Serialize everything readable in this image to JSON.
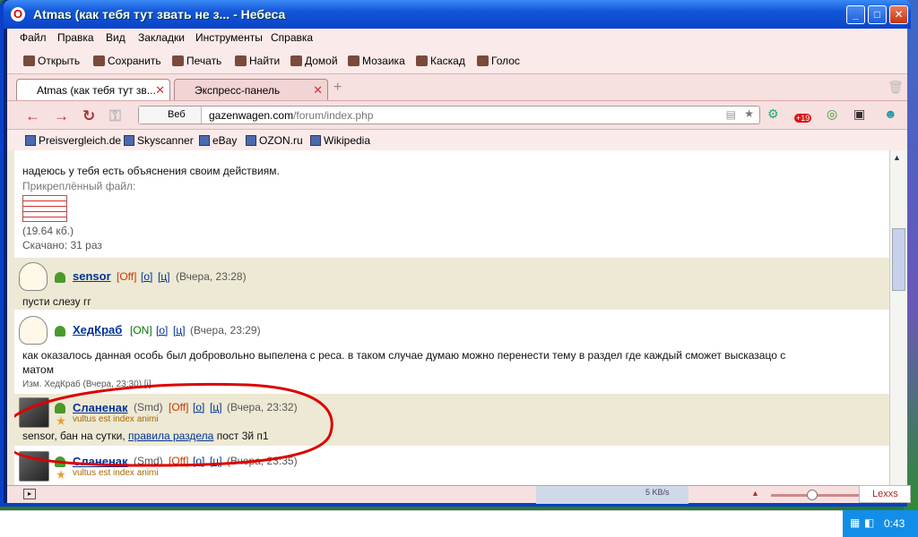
{
  "window": {
    "title": "Atmas (как тебя тут звать не з... - Небеса",
    "logo": "O"
  },
  "menu": [
    "Файл",
    "Правка",
    "Вид",
    "Закладки",
    "Инструменты",
    "Справка"
  ],
  "toolbar": [
    "Открыть",
    "Сохранить",
    "Печать",
    "Найти",
    "Домой",
    "Мозаика",
    "Каскад",
    "Голос"
  ],
  "tabs": [
    {
      "label": "Atmas (как тебя тут зв...",
      "active": true
    },
    {
      "label": "Экспресс-панель",
      "active": false
    }
  ],
  "address": {
    "mode": "Веб",
    "url_host": "gazenwagen.com",
    "url_path": "/forum/index.php",
    "badge": "+19"
  },
  "bookmarks": [
    "Preisvergleich.de",
    "Skyscanner",
    "eBay",
    "OZON.ru",
    "Wikipedia"
  ],
  "posts": [
    {
      "text": "надеюсь у тебя есть объяснения своим действиям.",
      "attached_label": "Прикреплённый файл:",
      "file_size": "(19.64 кб.)",
      "downloads": "Скачано: 31 раз"
    },
    {
      "user": "sensor",
      "status": "[Off]",
      "o": "[о]",
      "c": "[ц]",
      "time": "(Вчера, 23:28)",
      "text": "пусти слезу гг"
    },
    {
      "user": "ХедКраб",
      "status": "[ON]",
      "o": "[о]",
      "c": "[ц]",
      "time": "(Вчера, 23:29)",
      "text_line1": "как оказалось данная особь был добровольно выпелена с реса. в таком случае думаю можно перенести тему в раздел где каждый сможет высказацо с",
      "text_line2": "матом",
      "edit_note": "Изм. ХедКраб (Вчера, 23:30) [i]"
    },
    {
      "user": "Сланенак",
      "smd": "(Smd)",
      "status": "[Off]",
      "o": "[о]",
      "c": "[ц]",
      "time": "(Вчера, 23:32)",
      "motto": "vultus est index animi",
      "text_pre": "sensor, бан на сутки, ",
      "text_link": "правила раздела",
      "text_post": " пост 3й п1"
    },
    {
      "user": "Сланенак",
      "smd": "(Smd)",
      "status": "[Off]",
      "o": "[о]",
      "c": "[ц]",
      "time": "(Вчера, 23:35)",
      "motto": "vultus est index animi"
    }
  ],
  "status": {
    "speed": "5 KB/s",
    "lexxs": "Lexxs"
  },
  "tray": {
    "clock": "0:43"
  },
  "colors": {
    "accent": "#0a44c7",
    "link": "#003399",
    "off": "#cc3300",
    "on": "#007700",
    "circle": "#dd0000"
  }
}
